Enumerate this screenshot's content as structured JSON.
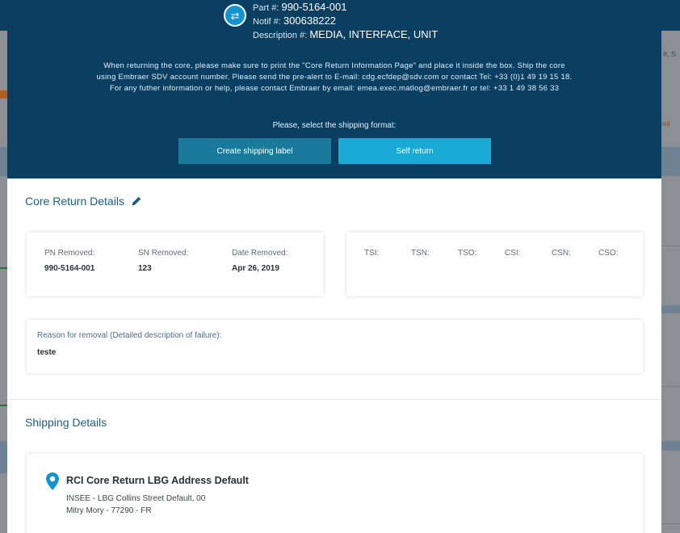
{
  "background": {
    "search_hint": "#, S",
    "status_hint": "red"
  },
  "header": {
    "icon": "swap-arrows-icon",
    "part_label": "Part #:",
    "part_value": "990-5164-001",
    "notif_label": "Notif #:",
    "notif_value": "300638222",
    "desc_label": "Description #:",
    "desc_value": "MEDIA, INTERFACE, UNIT",
    "notice_lines": [
      "When returning the core, please make sure to print the \"Core Return Information Page\" and place it inside the box. Ship the core",
      "using Embraer SDV account number. Please send the pre-alert to E-mail: cdg.ecfdep@sdv.com or contact Tel: +33 (0)1 49 19 15 18.",
      "For any futher information or help, please contact Embraer by email: emea.exec.matlog@embraer.fr or tel: +33 1 49 38 56 33"
    ],
    "select_label": "Please, select the shipping format:",
    "create_label_button": "Create shipping label",
    "self_return_button": "Self return"
  },
  "core_return": {
    "title": "Core Return Details",
    "edit_icon": "pencil-icon",
    "pn_label": "PN Removed:",
    "pn_value": "990-5164-001",
    "sn_label": "SN Removed:",
    "sn_value": "123",
    "date_label": "Date Removed:",
    "date_value": "Apr 26, 2019",
    "counters": [
      "TSI:",
      "TSN:",
      "TSO:",
      "CSI:",
      "CSN:",
      "CSO:"
    ],
    "reason_label": "Reason for removal (Detailed description of failure):",
    "reason_value": "teste"
  },
  "shipping": {
    "title": "Shipping Details",
    "pin_icon": "map-pin-icon",
    "address_title": "RCI Core Return LBG Address Default",
    "address_line1": "INSEE - LBG Collins Street Default, 00",
    "address_line2": "Mitry Mory - 77290 - FR"
  },
  "colors": {
    "header_bg": "#0b3f62",
    "accent": "#18a9d5",
    "button_dark": "#1a7a9c",
    "section_title": "#15618e"
  }
}
